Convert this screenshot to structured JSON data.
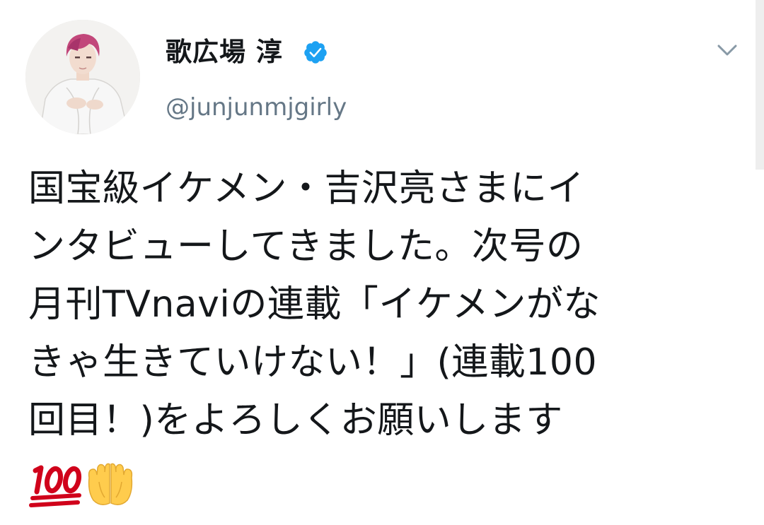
{
  "tweet": {
    "author": {
      "display_name": "歌広場 淳",
      "handle": "@junjunmjgirly",
      "verified": true,
      "avatar_icon": "avatar-photo",
      "verified_icon": "verified-badge-icon"
    },
    "menu_icon": "chevron-down-icon",
    "text_lines": [
      "国宝級イケメン・吉沢亮さまにイ",
      "ンタビューしてきました。次号の",
      "月刊TVnaviの連載「イケメンがな",
      "きゃ生きていけない！」(連載100",
      "回目！)をよろしくお願いします"
    ],
    "emojis": [
      "hundred-points-emoji",
      "palms-up-together-emoji"
    ]
  },
  "colors": {
    "verified_blue": "#1da1f2",
    "handle_gray": "#657786",
    "text": "#14171a",
    "hundred_red": "#d0021b",
    "hands_yellow": "#ffcc4d"
  }
}
